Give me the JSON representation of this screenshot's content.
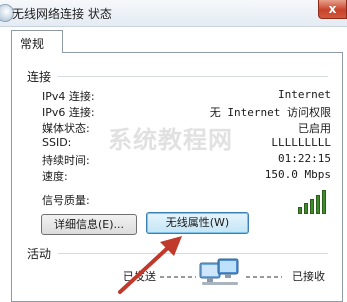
{
  "window": {
    "title": "无线网络连接 状态",
    "close_label": "x",
    "tabs": [
      "常规"
    ]
  },
  "connection": {
    "heading": "连接",
    "rows": [
      {
        "label": "IPv4 连接:",
        "value": "Internet"
      },
      {
        "label": "IPv6 连接:",
        "value": "无 Internet 访问权限"
      },
      {
        "label": "媒体状态:",
        "value": "已启用"
      },
      {
        "label": "SSID:",
        "value": "LLLLLLLLL"
      },
      {
        "label": "持续时间:",
        "value": "01:22:15"
      },
      {
        "label": "速度:",
        "value": "150.0 Mbps"
      }
    ],
    "signal_label": "信号质量:",
    "signal_level": 1.0
  },
  "buttons": {
    "details": "详细信息(E)...",
    "wireless_properties": "无线属性(W)"
  },
  "activity": {
    "heading": "活动",
    "sent_label": "已发送",
    "received_label": "已接收"
  },
  "watermark": "系统教程网",
  "colors": {
    "focus_button": "#c4e5f6",
    "signal_bar": "#3f8a2b",
    "arrow": "#c0392b"
  }
}
